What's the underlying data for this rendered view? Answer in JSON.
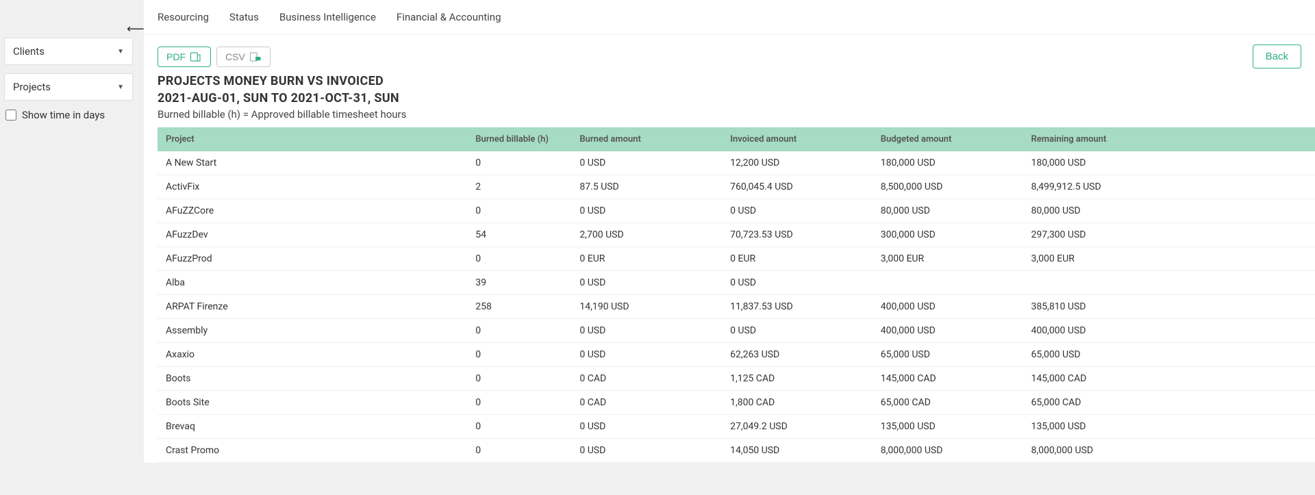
{
  "sidebar": {
    "clients_label": "Clients",
    "projects_label": "Projects",
    "show_time_label": "Show time in days"
  },
  "tabs": [
    "Resourcing",
    "Status",
    "Business Intelligence",
    "Financial & Accounting"
  ],
  "toolbar": {
    "pdf_label": "PDF",
    "csv_label": "CSV",
    "back_label": "Back"
  },
  "report": {
    "title": "PROJECTS MONEY BURN VS INVOICED",
    "date_range": "2021-AUG-01, SUN TO 2021-OCT-31, SUN",
    "subtitle": "Burned billable (h) = Approved billable timesheet hours"
  },
  "table": {
    "headers": [
      "Project",
      "Burned billable (h)",
      "Burned amount",
      "Invoiced amount",
      "Budgeted amount",
      "Remaining amount"
    ],
    "rows": [
      {
        "project": "A New Start",
        "burned_h": "0",
        "burned_a": "0 USD",
        "invoiced": "12,200 USD",
        "budgeted": "180,000 USD",
        "remaining": "180,000 USD"
      },
      {
        "project": "ActivFix",
        "burned_h": "2",
        "burned_a": "87.5 USD",
        "invoiced": "760,045.4 USD",
        "budgeted": "8,500,000 USD",
        "remaining": "8,499,912.5 USD"
      },
      {
        "project": "AFuZZCore",
        "burned_h": "0",
        "burned_a": "0 USD",
        "invoiced": "0 USD",
        "budgeted": "80,000 USD",
        "remaining": "80,000 USD"
      },
      {
        "project": "AFuzzDev",
        "burned_h": "54",
        "burned_a": "2,700 USD",
        "invoiced": "70,723.53 USD",
        "budgeted": "300,000 USD",
        "remaining": "297,300 USD"
      },
      {
        "project": "AFuzzProd",
        "burned_h": "0",
        "burned_a": "0 EUR",
        "invoiced": "0 EUR",
        "budgeted": "3,000 EUR",
        "remaining": "3,000 EUR"
      },
      {
        "project": "Alba",
        "burned_h": "39",
        "burned_a": "0 USD",
        "invoiced": "0 USD",
        "budgeted": "",
        "remaining": ""
      },
      {
        "project": "ARPAT Firenze",
        "burned_h": "258",
        "burned_a": "14,190 USD",
        "invoiced": "11,837.53 USD",
        "budgeted": "400,000 USD",
        "remaining": "385,810 USD"
      },
      {
        "project": "Assembly",
        "burned_h": "0",
        "burned_a": "0 USD",
        "invoiced": "0 USD",
        "budgeted": "400,000 USD",
        "remaining": "400,000 USD"
      },
      {
        "project": "Axaxio",
        "burned_h": "0",
        "burned_a": "0 USD",
        "invoiced": "62,263 USD",
        "budgeted": "65,000 USD",
        "remaining": "65,000 USD"
      },
      {
        "project": "Boots",
        "burned_h": "0",
        "burned_a": "0 CAD",
        "invoiced": "1,125 CAD",
        "budgeted": "145,000 CAD",
        "remaining": "145,000 CAD"
      },
      {
        "project": "Boots Site",
        "burned_h": "0",
        "burned_a": "0 CAD",
        "invoiced": "1,800 CAD",
        "budgeted": "65,000 CAD",
        "remaining": "65,000 CAD"
      },
      {
        "project": "Brevaq",
        "burned_h": "0",
        "burned_a": "0 USD",
        "invoiced": "27,049.2 USD",
        "budgeted": "135,000 USD",
        "remaining": "135,000 USD"
      },
      {
        "project": "Crast Promo",
        "burned_h": "0",
        "burned_a": "0 USD",
        "invoiced": "14,050 USD",
        "budgeted": "8,000,000 USD",
        "remaining": "8,000,000 USD"
      }
    ]
  }
}
